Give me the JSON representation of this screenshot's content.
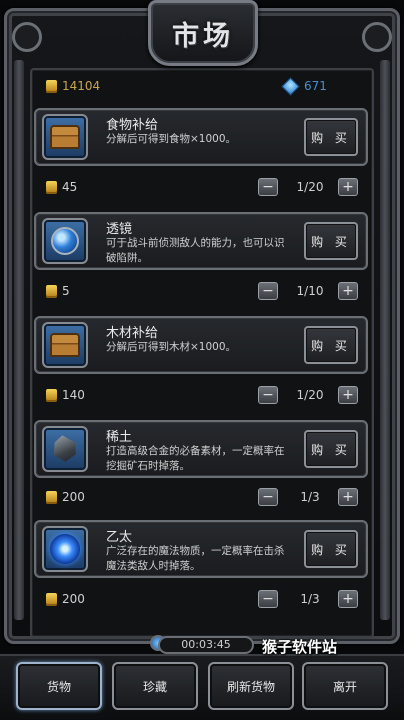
{
  "title": "市场",
  "currency": {
    "gold": "14104",
    "gems": "671"
  },
  "items": [
    {
      "name": "食物补给",
      "desc": "分解后可得到食物×1000。",
      "icon": "chest-icon",
      "buy_label": "购 买",
      "price": "45",
      "qty": "1/20"
    },
    {
      "name": "透镜",
      "desc": "可于战斗前侦测敌人的能力，也可以识破陷阱。",
      "icon": "lens-icon",
      "buy_label": "购 买",
      "price": "5",
      "qty": "1/10"
    },
    {
      "name": "木材补给",
      "desc": "分解后可得到木材×1000。",
      "icon": "chest-icon",
      "buy_label": "购 买",
      "price": "140",
      "qty": "1/20"
    },
    {
      "name": "稀土",
      "desc": "打造高级合金的必备素材，一定概率在挖掘矿石时掉落。",
      "icon": "ore-icon",
      "buy_label": "购 买",
      "price": "200",
      "qty": "1/3"
    },
    {
      "name": "乙太",
      "desc": "广泛存在的魔法物质，一定概率在击杀魔法类敌人时掉落。",
      "icon": "ether-icon",
      "buy_label": "购 买",
      "price": "200",
      "qty": "1/3"
    }
  ],
  "qty_controls": {
    "minus": "−",
    "plus": "+"
  },
  "timer": "00:03:45",
  "watermark": "猴子软件站",
  "nav": {
    "goods": "货物",
    "treasures": "珍藏",
    "refresh": "刷新货物",
    "leave": "离开"
  }
}
